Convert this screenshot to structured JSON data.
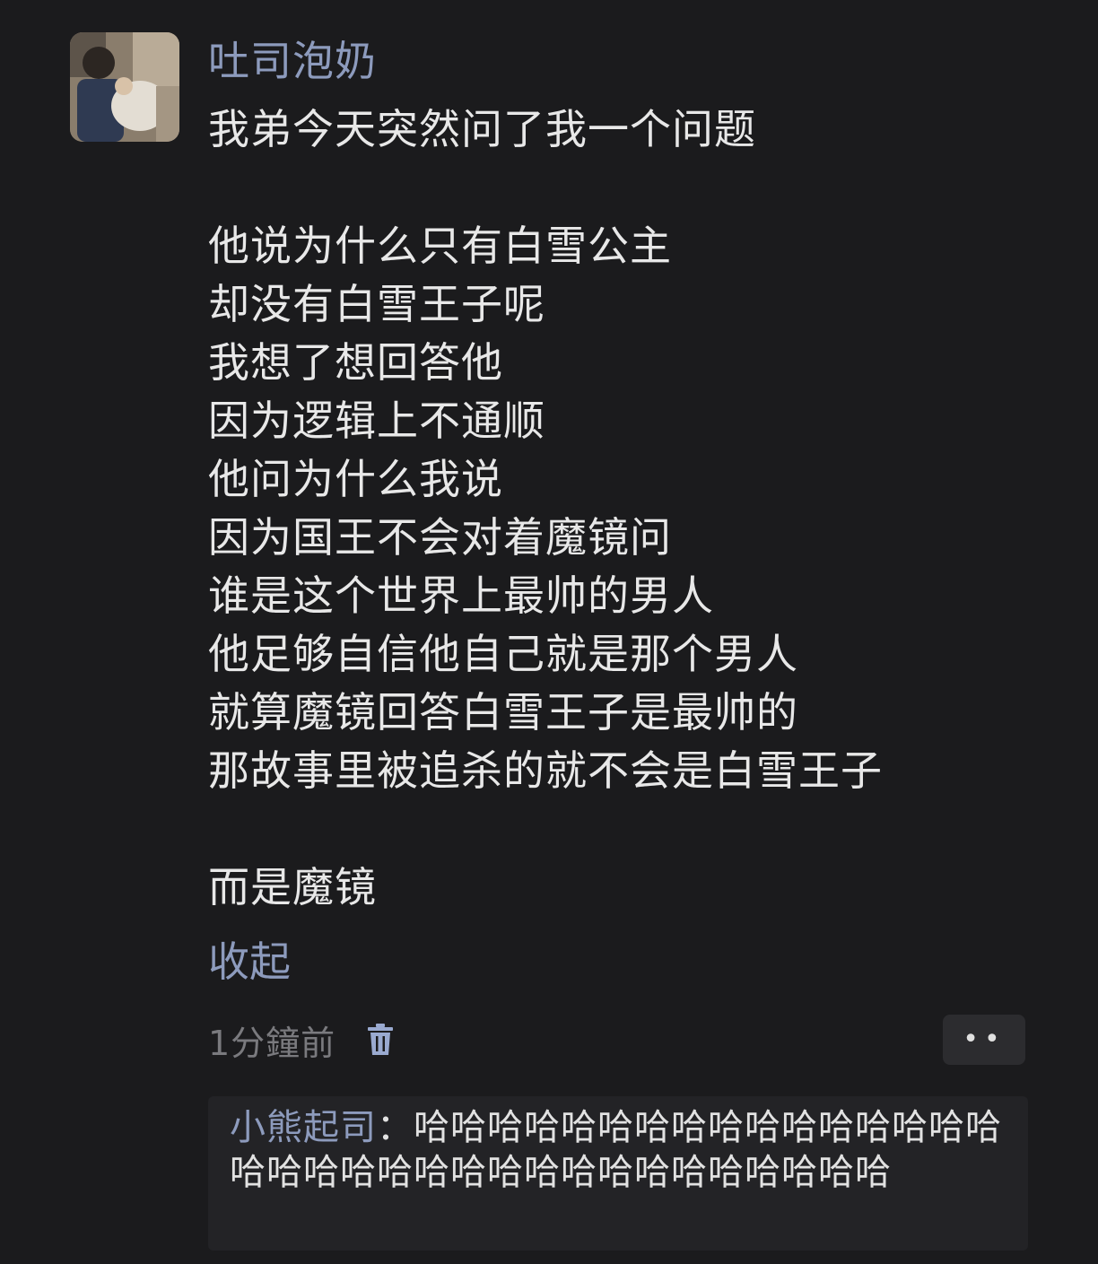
{
  "post": {
    "username": "吐司泡奶",
    "lines": [
      "我弟今天突然问了我一个问题",
      "",
      "他说为什么只有白雪公主",
      "却没有白雪王子呢",
      "我想了想回答他",
      "因为逻辑上不通顺",
      "他问为什么我说",
      "因为国王不会对着魔镜问",
      "谁是这个世界上最帅的男人",
      "他足够自信他自己就是那个男人",
      "就算魔镜回答白雪王子是最帅的",
      "那故事里被追杀的就不会是白雪王子",
      "",
      "而是魔镜"
    ],
    "collapse_label": "收起",
    "timestamp": "1分鐘前",
    "more_label": "••"
  },
  "reply": {
    "author": "小熊起司",
    "separator": "：",
    "text": "哈哈哈哈哈哈哈哈哈哈哈哈哈哈哈哈哈哈哈哈哈哈哈哈哈哈哈哈哈哈哈哈哈哈"
  },
  "icons": {
    "trash": "trash-icon",
    "avatar": "avatar-photo"
  },
  "colors": {
    "background": "#1b1b1d",
    "accent": "#8d9bbd",
    "text": "#e8e8e8",
    "muted": "#7a7a7e"
  }
}
